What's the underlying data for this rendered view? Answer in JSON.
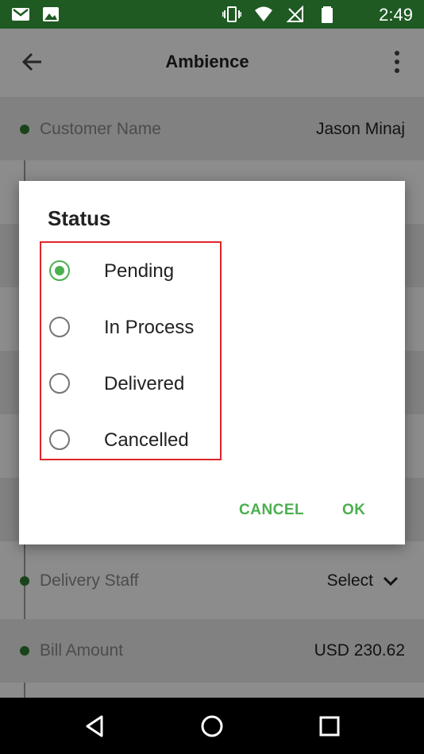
{
  "status_bar": {
    "time": "2:49",
    "icons_left": [
      "gmail-icon",
      "image-icon"
    ],
    "icons_right": [
      "vibrate-icon",
      "wifi-icon",
      "no-signal-icon",
      "battery-icon"
    ]
  },
  "app_bar": {
    "title": "Ambience",
    "back_icon": "arrow-back-icon",
    "menu_icon": "more-vert-icon"
  },
  "form": {
    "customer_name_label": "Customer Name",
    "customer_name_value": "Jason Minaj",
    "delivery_staff_label": "Delivery Staff",
    "delivery_staff_value": "Select",
    "bill_amount_label": "Bill Amount",
    "bill_amount_value": "USD 230.62"
  },
  "dialog": {
    "title": "Status",
    "options": [
      {
        "label": "Pending",
        "selected": true
      },
      {
        "label": "In Process",
        "selected": false
      },
      {
        "label": "Delivered",
        "selected": false
      },
      {
        "label": "Cancelled",
        "selected": false
      }
    ],
    "cancel_label": "CANCEL",
    "ok_label": "OK"
  },
  "colors": {
    "status_bar": "#1e5a22",
    "accent": "#4caf50",
    "highlight_border": "#e0252b"
  },
  "nav_bar": {
    "icons": [
      "back-triangle-icon",
      "home-circle-icon",
      "recents-square-icon"
    ]
  }
}
